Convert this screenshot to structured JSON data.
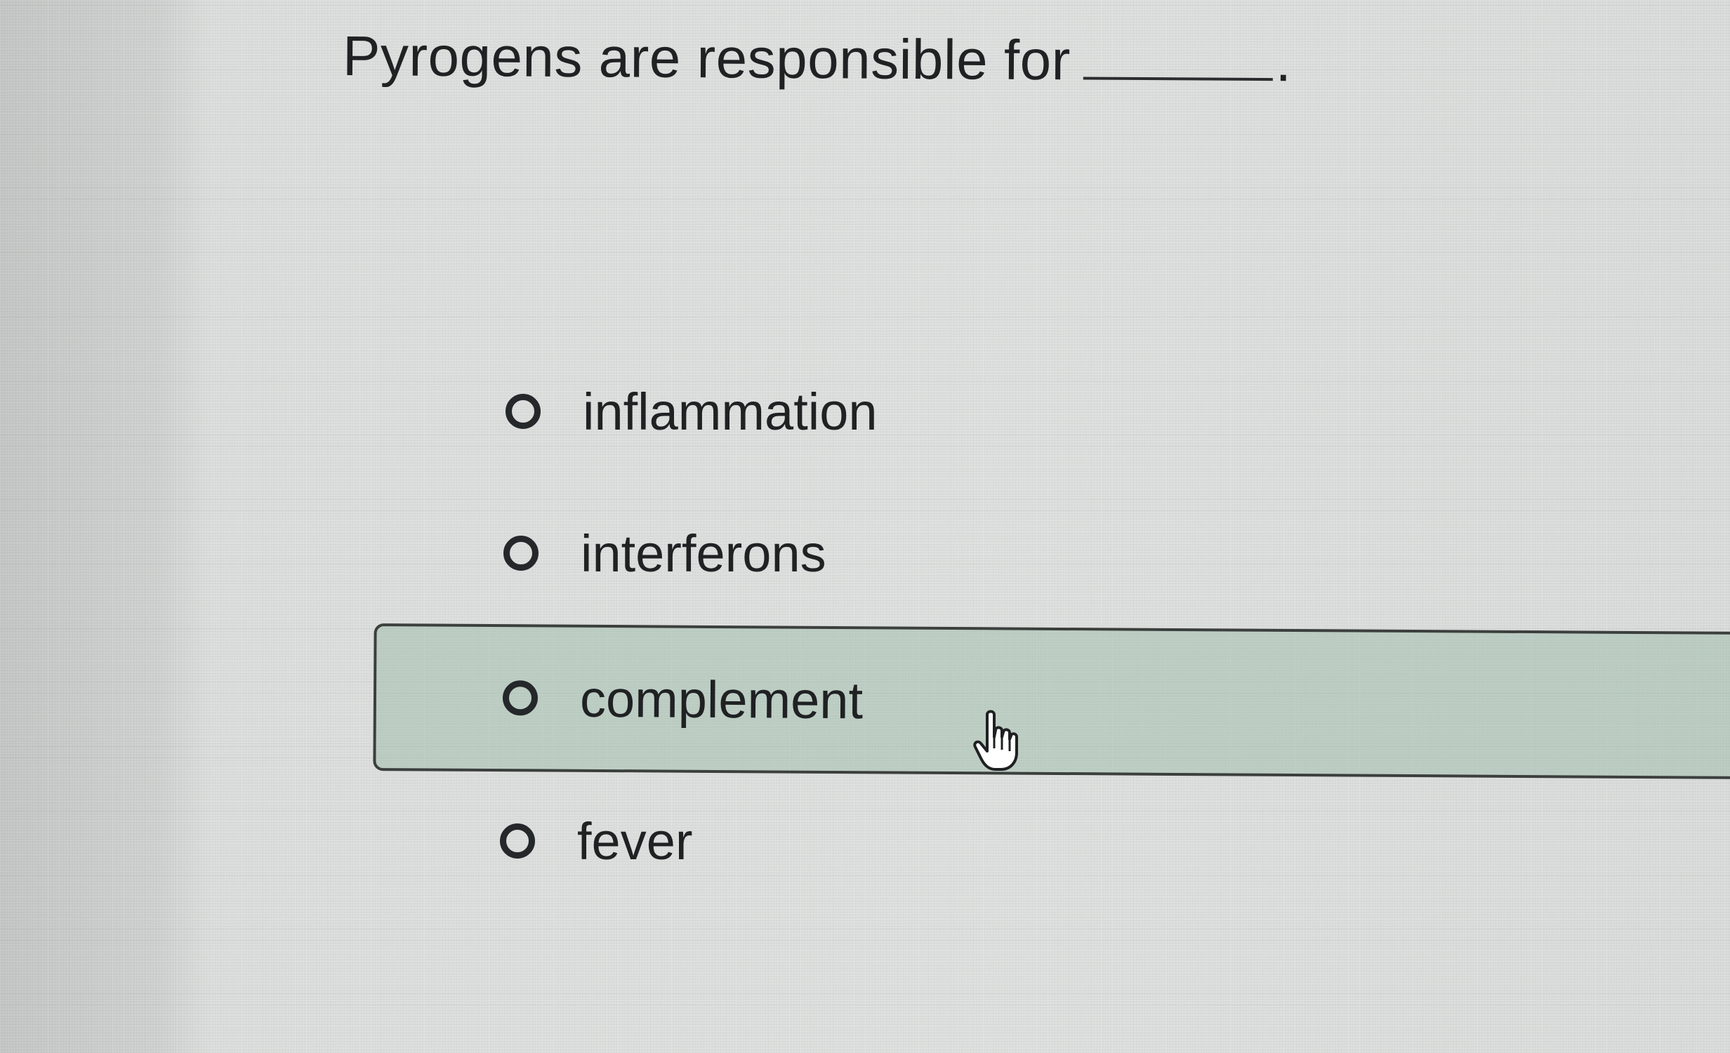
{
  "question": {
    "text": "Pyrogens are responsible for",
    "blank_end": "."
  },
  "choices": [
    {
      "label": "inflammation",
      "selected": false,
      "hovered": false
    },
    {
      "label": "interferons",
      "selected": false,
      "hovered": false
    },
    {
      "label": "complement",
      "selected": false,
      "hovered": true
    },
    {
      "label": "fever",
      "selected": false,
      "hovered": false
    }
  ],
  "cursor": {
    "icon": "hand-pointer-icon"
  }
}
